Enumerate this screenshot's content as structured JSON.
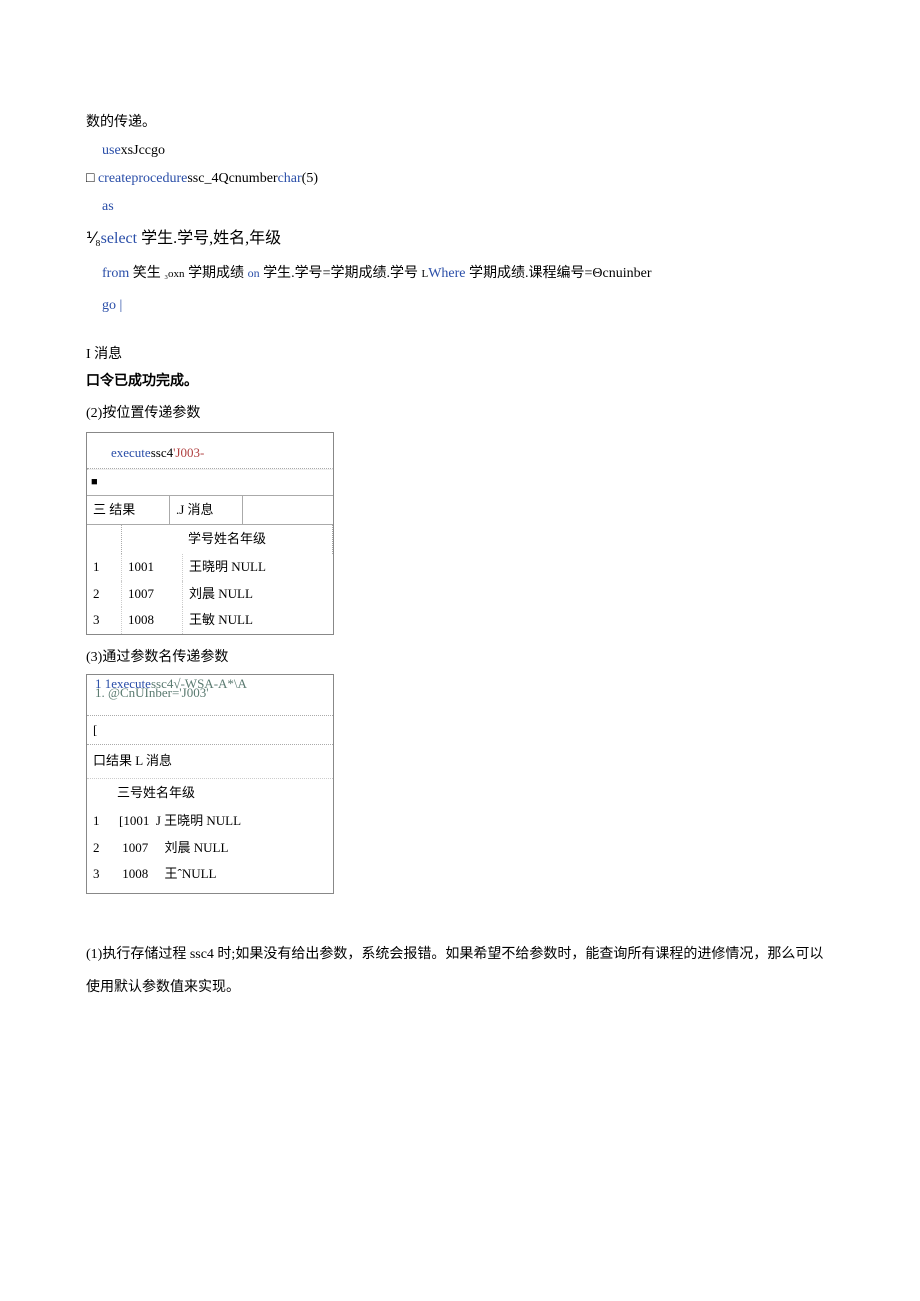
{
  "line1": "数的传递。",
  "code": {
    "l1a": "use",
    "l1b": "xsJccgo",
    "l2_prefix": "□ ",
    "l2a": "create",
    "l2b": "procedure",
    "l2c": "ssc_4",
    "l2d": "Qcnumber",
    "l2e": "char",
    "l2f": "(5)",
    "l3": "as",
    "l4_prefix": "⅟₈",
    "l4a": "select",
    "l4b": "学生",
    "l4c": ".",
    "l4d": "学号",
    "l4e": ",",
    "l4f": "姓名",
    "l4g": ",",
    "l4h": "年级",
    "l5a": "from",
    "l5b": "笑生",
    "l5c": "₃oxn",
    "l5d": "学期成绩",
    "l5e": "on",
    "l5f": "学生",
    "l5g": ".",
    "l5h": "学号",
    "l5i": "=",
    "l5j": "学期成绩",
    "l5k": ".",
    "l5l": "学号",
    "l5m": "L",
    "l5n": "Where",
    "l5o": "学期成绩",
    "l5p": ".",
    "l5q": "课程编号",
    "l5r": "=",
    "l5s": "Θcnuinber",
    "l6": "go |"
  },
  "msg_label": "I 消息",
  "success": "口令已成功完成。",
  "section2": "(2)按位置传递参数",
  "box1": {
    "sql_a": "execute",
    "sql_b": "ssc4",
    "sql_c": "'J003-",
    "square": "■",
    "tab1": "三 结果",
    "tab2": ".J 消息",
    "hdr": "学号姓名年级",
    "rows": [
      {
        "n": "1",
        "id": "1001",
        "name": "王晓明 NULL"
      },
      {
        "n": "2",
        "id": "1007",
        "name": "刘晨 NULL"
      },
      {
        "n": "3",
        "id": "1008",
        "name": "王敏 NULL"
      }
    ]
  },
  "section3": "(3)通过参数名传递参数",
  "box2": {
    "sql_l1": "1 1execute",
    "sql_l1b": "ssc4√-WSA-A*\\A",
    "sql_l2": "1. @CnUInber='J003'",
    "bracket": "[",
    "tabs": "口结果 L 消息",
    "hdr": "三号姓名年级",
    "r1": "1      [1001  J 王晓明 NULL",
    "r2": "2       1007     刘晨 NULL",
    "r3": "3       1008     王ˆNULL"
  },
  "para1": "(1)执行存储过程 ssc4 时;如果没有给出参数，系统会报错。如果希望不给参数时，能查询所有课程的进修情况，那么可以使用默认参数值来实现。"
}
